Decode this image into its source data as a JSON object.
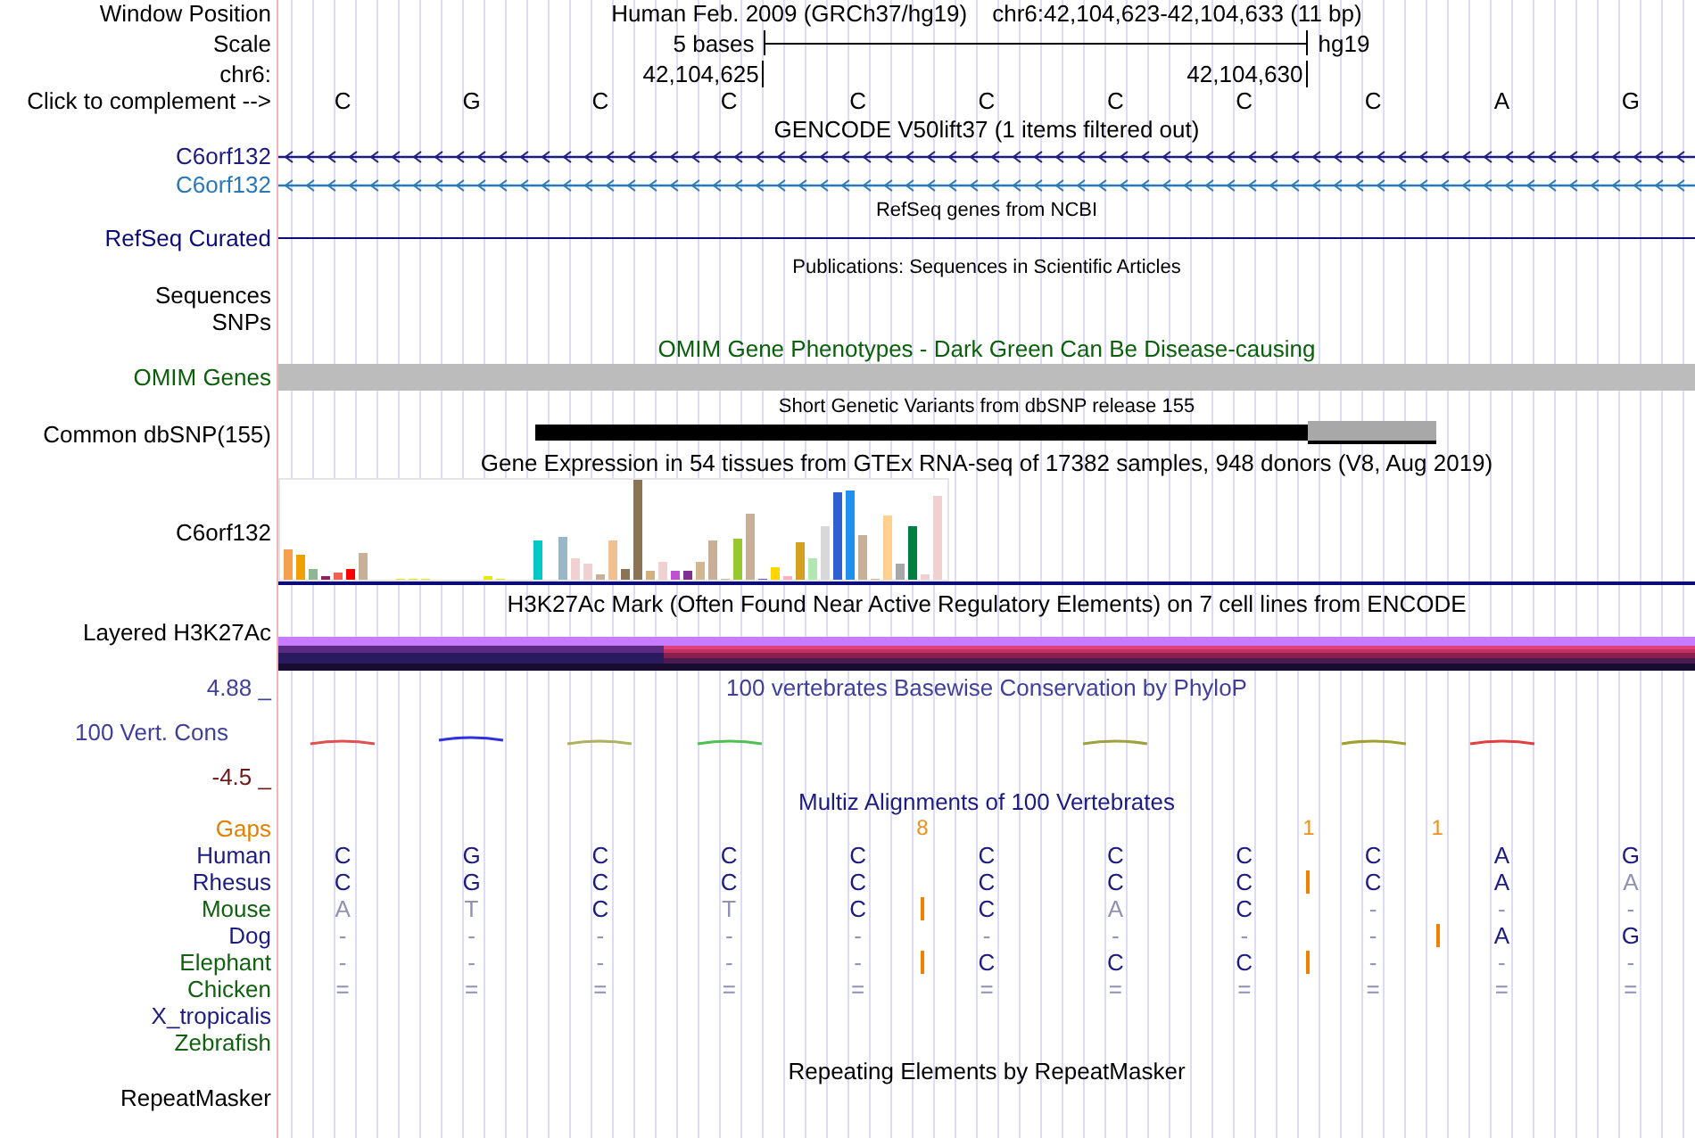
{
  "header": {
    "window_label": "Window Position",
    "title": "Human Feb. 2009 (GRCh37/hg19)",
    "position": "chr6:42,104,623-42,104,633 (11 bp)",
    "scale_label": "Scale",
    "scale_text": "5 bases",
    "assembly": "hg19",
    "chrom_label": "chr6:",
    "coord_start": "42,104,625",
    "coord_end": "42,104,630",
    "complement_label": "Click to complement -->",
    "bases": [
      "C",
      "G",
      "C",
      "C",
      "C",
      "C",
      "C",
      "C",
      "C",
      "A",
      "G"
    ]
  },
  "gencode": {
    "title": "GENCODE V50lift37 (1 items filtered out)",
    "transcripts": [
      {
        "name": "C6orf132",
        "color": "#1c1c80"
      },
      {
        "name": "C6orf132",
        "color": "#2a78b8"
      }
    ]
  },
  "refseq": {
    "title": "RefSeq genes from NCBI",
    "label": "RefSeq Curated"
  },
  "publications": {
    "title": "Publications: Sequences in Scientific Articles",
    "labels": [
      "Sequences",
      "SNPs"
    ]
  },
  "omim": {
    "title": "OMIM Gene Phenotypes - Dark Green Can Be Disease-causing",
    "label": "OMIM Genes"
  },
  "dbsnp": {
    "title": "Short Genetic Variants from dbSNP release 155",
    "label": "Common dbSNP(155)"
  },
  "gtex": {
    "title": "Gene Expression in 54 tissues from GTEx RNA-seq of 17382 samples, 948 donors (V8, Aug 2019)",
    "label": "C6orf132"
  },
  "h3k27ac": {
    "title": "H3K27Ac Mark (Often Found Near Active Regulatory Elements) on 7 cell lines from ENCODE",
    "label": "Layered H3K27Ac"
  },
  "conservation": {
    "title": "100 vertebrates Basewise Conservation by PhyloP",
    "label": "100 Vert. Cons",
    "max": "4.88 _",
    "min": "-4.5 _"
  },
  "multiz": {
    "title": "Multiz Alignments of 100 Vertebrates",
    "gaps_label": "Gaps",
    "species": [
      {
        "name": "Human",
        "color": "#1c1c80",
        "bases": [
          {
            "base": "C",
            "faded": false,
            "insertion_after": false
          },
          {
            "base": "G",
            "faded": false,
            "insertion_after": false
          },
          {
            "base": "C",
            "faded": false,
            "insertion_after": false
          },
          {
            "base": "C",
            "faded": false,
            "insertion_after": false
          },
          {
            "base": "C",
            "faded": false,
            "insertion_after": false,
            "gap_count": "8"
          },
          {
            "base": "C",
            "faded": false,
            "insertion_after": false
          },
          {
            "base": "C",
            "faded": false,
            "insertion_after": false
          },
          {
            "base": "C",
            "faded": false,
            "insertion_after": false,
            "gap_count": "1"
          },
          {
            "base": "C",
            "faded": false,
            "insertion_after": false,
            "gap_count": "1"
          },
          {
            "base": "A",
            "faded": false,
            "insertion_after": false
          },
          {
            "base": "G",
            "faded": false,
            "insertion_after": false
          }
        ]
      },
      {
        "name": "Rhesus",
        "color": "#1c1c80",
        "bases": [
          {
            "base": "C",
            "faded": false,
            "insertion_after": false
          },
          {
            "base": "G",
            "faded": false,
            "insertion_after": false
          },
          {
            "base": "C",
            "faded": false,
            "insertion_after": false
          },
          {
            "base": "C",
            "faded": false,
            "insertion_after": false
          },
          {
            "base": "C",
            "faded": false,
            "insertion_after": false
          },
          {
            "base": "C",
            "faded": false,
            "insertion_after": false
          },
          {
            "base": "C",
            "faded": false,
            "insertion_after": false
          },
          {
            "base": "C",
            "faded": false,
            "insertion_after": true
          },
          {
            "base": "C",
            "faded": false,
            "insertion_after": false
          },
          {
            "base": "A",
            "faded": false,
            "insertion_after": false
          },
          {
            "base": "A",
            "faded": true,
            "insertion_after": false
          }
        ]
      },
      {
        "name": "Mouse",
        "color": "#106010",
        "bases": [
          {
            "base": "A",
            "faded": true,
            "insertion_after": false
          },
          {
            "base": "T",
            "faded": true,
            "insertion_after": false
          },
          {
            "base": "C",
            "faded": false,
            "insertion_after": false
          },
          {
            "base": "T",
            "faded": true,
            "insertion_after": false
          },
          {
            "base": "C",
            "faded": false,
            "insertion_after": true
          },
          {
            "base": "C",
            "faded": false,
            "insertion_after": false
          },
          {
            "base": "A",
            "faded": true,
            "insertion_after": false
          },
          {
            "base": "C",
            "faded": false,
            "insertion_after": false
          },
          {
            "base": "-",
            "faded": true,
            "insertion_after": false
          },
          {
            "base": "-",
            "faded": true,
            "insertion_after": false
          },
          {
            "base": "-",
            "faded": true,
            "insertion_after": false
          }
        ]
      },
      {
        "name": "Dog",
        "color": "#1c1c80",
        "bases": [
          {
            "base": "-",
            "faded": true,
            "insertion_after": false
          },
          {
            "base": "-",
            "faded": true,
            "insertion_after": false
          },
          {
            "base": "-",
            "faded": true,
            "insertion_after": false
          },
          {
            "base": "-",
            "faded": true,
            "insertion_after": false
          },
          {
            "base": "-",
            "faded": true,
            "insertion_after": false
          },
          {
            "base": "-",
            "faded": true,
            "insertion_after": false
          },
          {
            "base": "-",
            "faded": true,
            "insertion_after": false
          },
          {
            "base": "-",
            "faded": true,
            "insertion_after": false
          },
          {
            "base": "-",
            "faded": true,
            "insertion_after": true
          },
          {
            "base": "A",
            "faded": false,
            "insertion_after": false
          },
          {
            "base": "G",
            "faded": false,
            "insertion_after": false
          }
        ]
      },
      {
        "name": "Elephant",
        "color": "#106010",
        "bases": [
          {
            "base": "-",
            "faded": true,
            "insertion_after": false
          },
          {
            "base": "-",
            "faded": true,
            "insertion_after": false
          },
          {
            "base": "-",
            "faded": true,
            "insertion_after": false
          },
          {
            "base": "-",
            "faded": true,
            "insertion_after": false
          },
          {
            "base": "-",
            "faded": true,
            "insertion_after": true
          },
          {
            "base": "C",
            "faded": false,
            "insertion_after": false
          },
          {
            "base": "C",
            "faded": false,
            "insertion_after": false
          },
          {
            "base": "C",
            "faded": false,
            "insertion_after": true
          },
          {
            "base": "-",
            "faded": true,
            "insertion_after": false
          },
          {
            "base": "-",
            "faded": true,
            "insertion_after": false
          },
          {
            "base": "-",
            "faded": true,
            "insertion_after": false
          }
        ]
      },
      {
        "name": "Chicken",
        "color": "#106010",
        "bases": [
          {
            "base": "=",
            "faded": true,
            "insertion_after": false
          },
          {
            "base": "=",
            "faded": true,
            "insertion_after": false
          },
          {
            "base": "=",
            "faded": true,
            "insertion_after": false
          },
          {
            "base": "=",
            "faded": true,
            "insertion_after": false
          },
          {
            "base": "=",
            "faded": true,
            "insertion_after": false
          },
          {
            "base": "=",
            "faded": true,
            "insertion_after": false
          },
          {
            "base": "=",
            "faded": true,
            "insertion_after": false
          },
          {
            "base": "=",
            "faded": true,
            "insertion_after": false
          },
          {
            "base": "=",
            "faded": true,
            "insertion_after": false
          },
          {
            "base": "=",
            "faded": true,
            "insertion_after": false
          },
          {
            "base": "=",
            "faded": true,
            "insertion_after": false
          }
        ]
      },
      {
        "name": "X_tropicalis",
        "color": "#1c1c80"
      },
      {
        "name": "Zebrafish",
        "color": "#106010"
      }
    ]
  },
  "repeatmasker": {
    "title": "Repeating Elements by RepeatMasker",
    "label": "RepeatMasker"
  }
}
